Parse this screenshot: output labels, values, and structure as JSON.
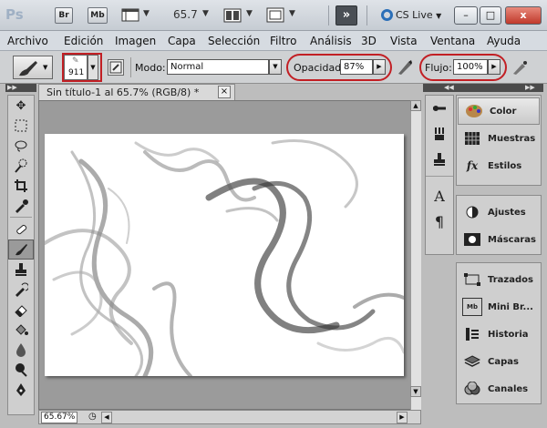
{
  "appbar": {
    "logo": "Ps",
    "br_label": "Br",
    "mb_label": "Mb",
    "zoom": "65.7",
    "cs_live": "CS Live",
    "min_label": "–",
    "max_label": "□",
    "close_label": "x"
  },
  "menu": [
    "Archivo",
    "Edición",
    "Imagen",
    "Capa",
    "Selección",
    "Filtro",
    "Análisis",
    "3D",
    "Vista",
    "Ventana",
    "Ayuda"
  ],
  "options": {
    "brush_size": "911",
    "mode_label": "Modo:",
    "mode_value": "Normal",
    "opacity_label": "Opacidad:",
    "opacity_value": "87%",
    "flow_label": "Flujo:",
    "flow_value": "100%"
  },
  "document": {
    "tab_title": "Sin título-1 al 65.7% (RGB/8) *",
    "tab_close": "×",
    "zoom_field": "65.67%"
  },
  "panels": {
    "group1": [
      {
        "label": "Color",
        "icon": "palette-icon",
        "active": true
      },
      {
        "label": "Muestras",
        "icon": "swatches-grid-icon",
        "active": false
      },
      {
        "label": "Estilos",
        "icon": "fx-styles-icon",
        "active": false
      }
    ],
    "group2": [
      {
        "label": "Ajustes",
        "icon": "adjustments-icon",
        "active": false
      },
      {
        "label": "Máscaras",
        "icon": "mask-icon",
        "active": false
      }
    ],
    "group3": [
      {
        "label": "Trazados",
        "icon": "paths-icon",
        "active": false
      },
      {
        "label": "Mini Br...",
        "icon": "mini-bridge-icon",
        "icon_text": "Mb",
        "active": false
      },
      {
        "label": "Historia",
        "icon": "history-icon",
        "active": false
      },
      {
        "label": "Capas",
        "icon": "layers-icon",
        "active": false
      },
      {
        "label": "Canales",
        "icon": "channels-icon",
        "active": false
      }
    ]
  }
}
